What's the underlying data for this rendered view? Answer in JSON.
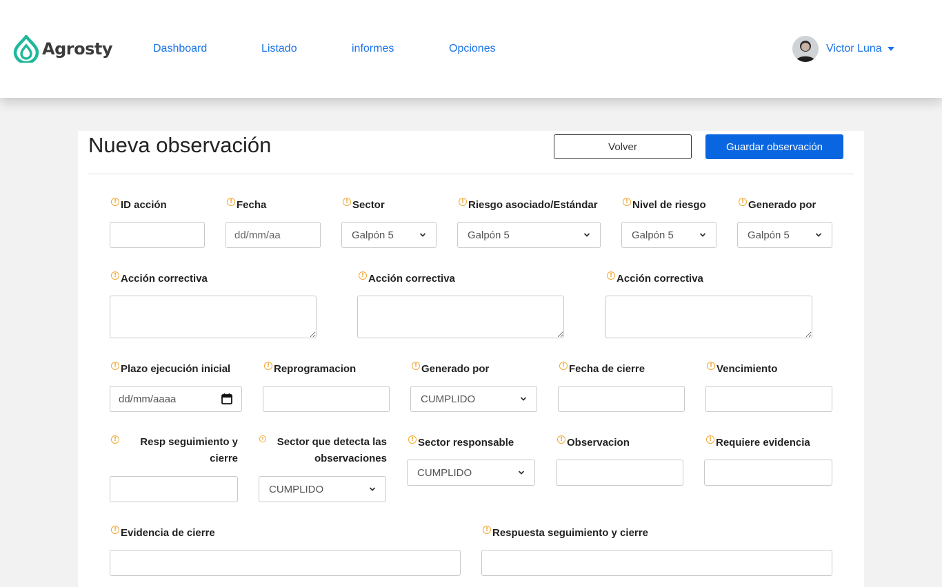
{
  "brand": {
    "name": "Agrosty",
    "accent": "#1fb99a"
  },
  "nav": [
    "Dashboard",
    "Listado",
    "informes",
    "Opciones"
  ],
  "user": {
    "name": "Victor Luna"
  },
  "page": {
    "title": "Nueva observación",
    "back_label": "Volver",
    "save_label": "Guardar observación"
  },
  "fields": {
    "id_accion": {
      "label": "ID acción",
      "value": ""
    },
    "fecha": {
      "label": "Fecha",
      "placeholder": "dd/mm/aa"
    },
    "sector": {
      "label": "Sector",
      "value": "Galpón 5"
    },
    "riesgo": {
      "label": "Riesgo asociado/Estándar",
      "value": "Galpón 5"
    },
    "nivel_riesgo": {
      "label": "Nivel de riesgo",
      "value": "Galpón 5"
    },
    "generado_por_1": {
      "label": "Generado por",
      "value": "Galpón 5"
    },
    "accion_correctiva_1": {
      "label": "Acción correctiva"
    },
    "accion_correctiva_2": {
      "label": "Acción correctiva"
    },
    "accion_correctiva_3": {
      "label": "Acción correctiva"
    },
    "plazo": {
      "label": "Plazo ejecución inicial",
      "value": "dd/mm/aaaa"
    },
    "reprogramacion": {
      "label": "Reprogramacion"
    },
    "generado_por_2": {
      "label": "Generado por",
      "value": "CUMPLIDO"
    },
    "fecha_cierre": {
      "label": "Fecha de cierre"
    },
    "vencimiento": {
      "label": "Vencimiento"
    },
    "resp_seguimiento": {
      "label": "Resp seguimiento y cierre"
    },
    "sector_detecta": {
      "label": "Sector que detecta las observaciones",
      "value": "CUMPLIDO"
    },
    "sector_responsable": {
      "label": "Sector responsable",
      "value": "CUMPLIDO"
    },
    "observacion": {
      "label": "Observacion"
    },
    "requiere_evidencia": {
      "label": "Requiere evidencia"
    },
    "evidencia_cierre": {
      "label": "Evidencia de cierre"
    },
    "respuesta_seguimiento": {
      "label": "Respuesta seguimiento y cierre"
    }
  }
}
